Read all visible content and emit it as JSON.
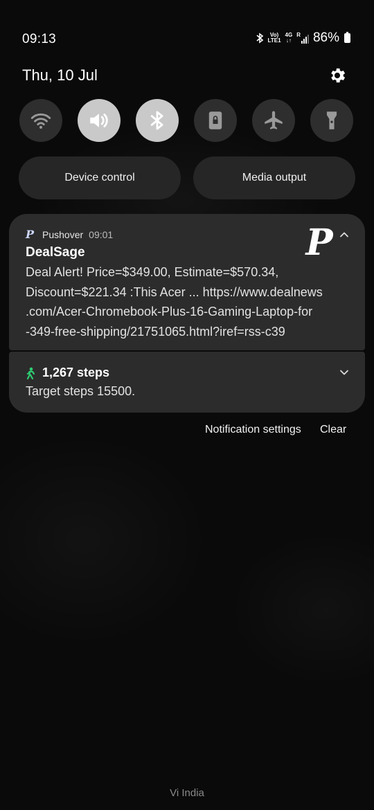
{
  "status_bar": {
    "time": "09:13",
    "volte": "Vo)",
    "lte": "LTE1",
    "net": "4G",
    "roaming": "R",
    "battery": "86%"
  },
  "header": {
    "date": "Thu, 10 Jul"
  },
  "quick_tiles": [
    {
      "icon": "wifi-icon",
      "active": false
    },
    {
      "icon": "sound-icon",
      "active": true
    },
    {
      "icon": "bluetooth-icon",
      "active": true
    },
    {
      "icon": "rotation-lock-icon",
      "active": false
    },
    {
      "icon": "airplane-icon",
      "active": false
    },
    {
      "icon": "flashlight-icon",
      "active": false
    }
  ],
  "buttons": {
    "device_control": "Device control",
    "media_output": "Media output"
  },
  "notifications": [
    {
      "app": "Pushover",
      "time": "09:01",
      "title": "DealSage",
      "lines": [
        "Deal Alert! Price=$349.00, Estimate=$570.34,",
        "Discount=$221.34 :This Acer ... https://www.dealnews",
        ".com/Acer-Chromebook-Plus-16-Gaming-Laptop-for",
        "-349-free-shipping/21751065.html?iref=rss-c39"
      ]
    },
    {
      "title": "1,267 steps",
      "text": "Target steps 15500."
    }
  ],
  "actions": {
    "settings": "Notification settings",
    "clear": "Clear"
  },
  "carrier": "Vi India",
  "colors": {
    "tile_off": "#2e2e2e",
    "tile_on": "#c9c9c9",
    "card": "#2c2c2c",
    "steps_green": "#2ecc71"
  }
}
